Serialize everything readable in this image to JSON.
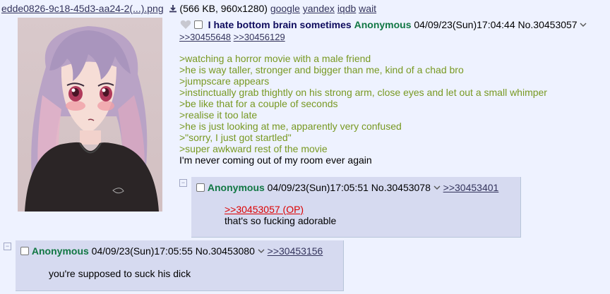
{
  "file": {
    "name": "edde0826-9c18-45d3-aa24-2(...).png",
    "info": "(566 KB, 960x1280)",
    "links": [
      "google",
      "yandex",
      "iqdb",
      "wait"
    ]
  },
  "op": {
    "subject": "I hate bottom brain sometimes",
    "name": "Anonymous",
    "datetime": "04/09/23(Sun)17:04:44",
    "number": "No.30453057",
    "backlinks": [
      ">>30455648",
      ">>30456129"
    ],
    "lines": [
      {
        "text": ">watching a horror movie with a male friend",
        "green": true
      },
      {
        "text": ">he is way taller, stronger and bigger than me, kind of a chad bro",
        "green": true
      },
      {
        "text": ">jumpscare appears",
        "green": true
      },
      {
        "text": ">instinctually grab thightly on his strong arm, close eyes and let out a small whimper",
        "green": true
      },
      {
        "text": ">be like that for a couple of seconds",
        "green": true
      },
      {
        "text": ">realise it too late",
        "green": true
      },
      {
        "text": ">he is just looking at me, apparently very confused",
        "green": true
      },
      {
        "text": ">\"sorry, I just got startled\"",
        "green": true
      },
      {
        "text": ">super awkward rest of the movie",
        "green": true
      },
      {
        "text": "I'm never coming out of my room ever again",
        "green": false
      }
    ]
  },
  "replies": [
    {
      "name": "Anonymous",
      "datetime": "04/09/23(Sun)17:05:51",
      "number": "No.30453078",
      "backlink": ">>30453401",
      "quote": ">>30453057 (OP)",
      "text": "that's so fucking adorable"
    },
    {
      "name": "Anonymous",
      "datetime": "04/09/23(Sun)17:05:55",
      "number": "No.30453080",
      "backlink": ">>30453156",
      "text": "you're supposed to suck his dick"
    }
  ],
  "colors": {
    "background": "#eef2ff",
    "reply_background": "#d6daf0",
    "name": "#117743",
    "subject": "#0f0c5d",
    "greentext": "#789922",
    "op_quote": "#dd0000",
    "link": "#34345c"
  },
  "icons": [
    "download-icon",
    "heart-icon",
    "chevron-down-icon",
    "minimize-icon",
    "checkbox"
  ]
}
